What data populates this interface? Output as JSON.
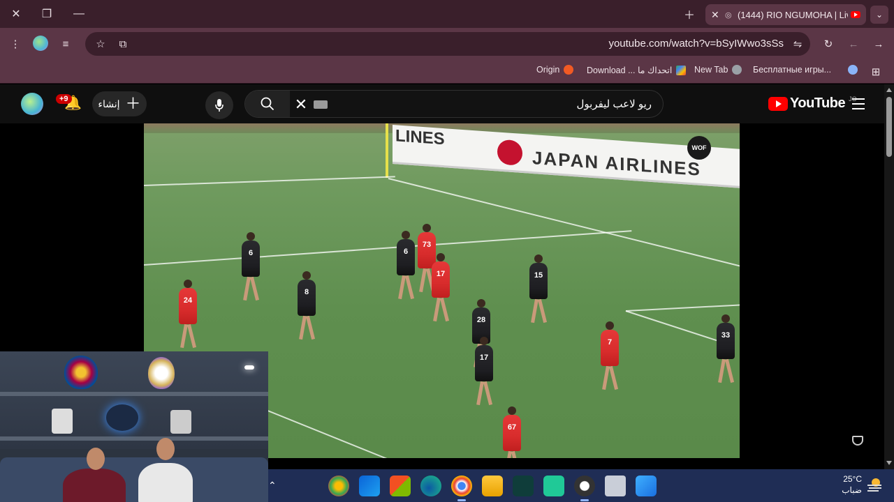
{
  "browser": {
    "tab": {
      "title": "(1444) RIO NGUMOHA | Liv",
      "close_glyph": "✕",
      "audio_glyph": "◎"
    },
    "url": "youtube.com/watch?v=bSyIWwo3sSs",
    "bookmarks": [
      {
        "label": "Origin",
        "color": "#f15a24"
      },
      {
        "label": "Download ... اتحداك ما",
        "color": "#34a853"
      },
      {
        "label": "New Tab",
        "color": "#9aa0a6"
      },
      {
        "label": "Бесплатные игры...",
        "color": "#8ab4f8"
      }
    ]
  },
  "youtube": {
    "notifications_count": "+9",
    "create_label": "إنشاء",
    "search_query": "ريو لاعب ليفربول",
    "logo_word": "YouTube",
    "region": "JO"
  },
  "video": {
    "board_text": "JAPAN AIRLINES",
    "board_left_text": "LINES",
    "channel_badge": "WOF",
    "players": [
      {
        "team": "red",
        "number": "24"
      },
      {
        "team": "dark",
        "number": "6"
      },
      {
        "team": "dark",
        "number": "8"
      },
      {
        "team": "red",
        "number": "73"
      },
      {
        "team": "red",
        "number": "17"
      },
      {
        "team": "dark",
        "number": "6"
      },
      {
        "team": "dark",
        "number": "15"
      },
      {
        "team": "dark",
        "number": "28"
      },
      {
        "team": "dark",
        "number": "17"
      },
      {
        "team": "red",
        "number": "7"
      },
      {
        "team": "dark",
        "number": "33"
      },
      {
        "team": "red",
        "number": "67"
      }
    ]
  },
  "taskbar": {
    "temperature": "25°C",
    "condition": "ضباب",
    "apps": [
      "chrome-canary",
      "outlook",
      "microsoft-store",
      "edge",
      "chrome",
      "file-explorer",
      "app-green",
      "app-teal",
      "obs",
      "task-view",
      "windows-start"
    ]
  },
  "colors": {
    "titlebar": "#3a1f2b",
    "toolbar": "#5b3646",
    "youtube_red": "#ff0000",
    "taskbar": "#1f2d55"
  }
}
